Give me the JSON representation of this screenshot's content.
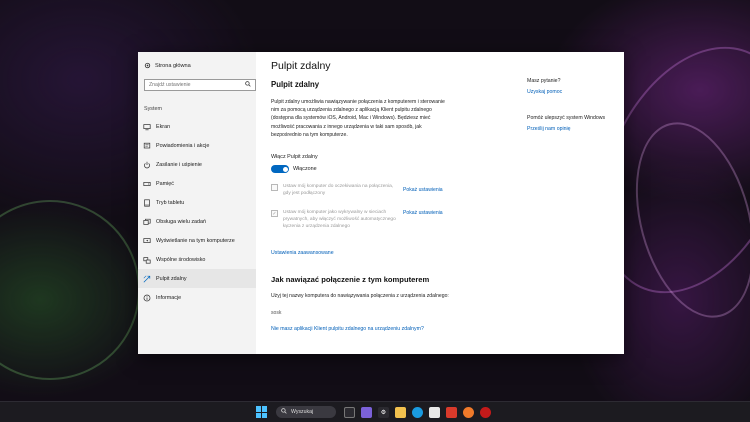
{
  "sidebar": {
    "home_label": "Strona główna",
    "search_placeholder": "Znajdź ustawienie",
    "section_title": "System",
    "items": [
      {
        "label": "Ekran",
        "icon": "monitor-icon"
      },
      {
        "label": "Powiadomienia i akcje",
        "icon": "notification-icon"
      },
      {
        "label": "Zasilanie i uśpienie",
        "icon": "power-icon"
      },
      {
        "label": "Pamięć",
        "icon": "storage-icon"
      },
      {
        "label": "Tryb tabletu",
        "icon": "tablet-icon"
      },
      {
        "label": "Obsługa wielu zadań",
        "icon": "multitasking-icon"
      },
      {
        "label": "Wyświetlanie na tym komputerze",
        "icon": "project-icon"
      },
      {
        "label": "Wspólne środowisko",
        "icon": "shared-icon"
      },
      {
        "label": "Pulpit zdalny",
        "icon": "remote-desktop-icon",
        "active": true
      },
      {
        "label": "Informacje",
        "icon": "info-icon"
      }
    ]
  },
  "main": {
    "page_title": "Pulpit zdalny",
    "sub_title": "Pulpit zdalny",
    "description": "Pulpit zdalny umożliwia nawiązywanie połączenia z komputerem i sterowanie nim za pomocą urządzenia zdalnego z aplikacją Klient pulpitu zdalnego (dostępna dla systemów iOS, Android, Mac i Windows). Będziesz mieć możliwość pracowania z innego urządzenia w taki sam sposób, jak bezpośrednio na tym komputerze.",
    "toggle_label": "Włącz Pulpit zdalny",
    "toggle_state": "Włączone",
    "checkbox1": "Ustaw mój komputer do oczekiwania na połączenia, gdy jest podłączony",
    "checkbox2": "Ustaw mój komputer jako wykrywalny w sieciach prywatnych, aby włączyć możliwość automatycznego łączenia z urządzenia zdalnego",
    "show_settings_1": "Pokaż ustawienia",
    "show_settings_2": "Pokaż ustawienia",
    "advanced_link": "Ustawienia zaawansowane",
    "how_to_connect_title": "Jak nawiązać połączenie z tym komputerem",
    "how_to_connect_desc": "Użyj tej nazwy komputera do nawiązywania połączenia z urządzenia zdalnego:",
    "pc_name": "sosk",
    "no_app_link": "Nie masz aplikacji Klient pulpitu zdalnego na urządzeniu zdalnym?"
  },
  "right": {
    "question": "Masz pytanie?",
    "help_link": "Uzyskaj pomoc",
    "improve": "Pomóż ulepszyć system Windows",
    "feedback_link": "Prześlij nam opinię"
  },
  "taskbar": {
    "search_label": "Wyszukaj"
  },
  "colors": {
    "accent": "#0067c0",
    "link": "#005fb8"
  }
}
